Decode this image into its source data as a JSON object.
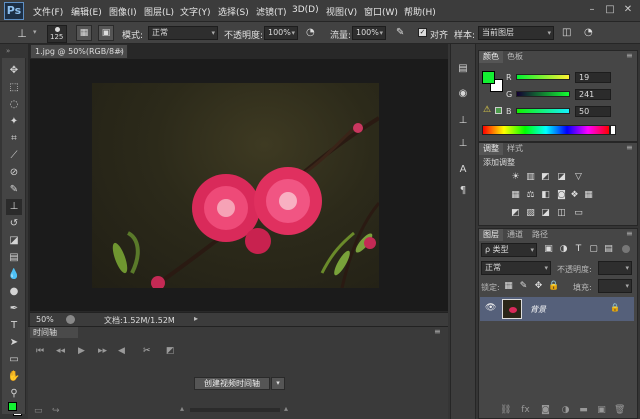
{
  "app": {
    "logo": "Ps"
  },
  "menu": [
    "文件(F)",
    "编辑(E)",
    "图像(I)",
    "图层(L)",
    "文字(Y)",
    "选择(S)",
    "滤镜(T)",
    "3D(D)",
    "视图(V)",
    "窗口(W)",
    "帮助(H)"
  ],
  "window_controls": [
    "–",
    "□",
    "✕"
  ],
  "options": {
    "brush_size": "125",
    "mode_label": "模式:",
    "mode_value": "正常",
    "opacity_label": "不透明度:",
    "opacity_value": "100%",
    "flow_label": "流量:",
    "flow_value": "100%",
    "align_label": "对齐",
    "sample_label": "样本:",
    "sample_value": "当前图层"
  },
  "document": {
    "tab_title": "1.jpg @ 50%(RGB/8#) *",
    "zoom": "50%",
    "doc_info": "文档:1.52M/1.52M"
  },
  "timeline": {
    "tab": "时间轴",
    "create_button": "创建视频时间轴"
  },
  "color_panel": {
    "tabs": [
      "颜色",
      "色板"
    ],
    "r_label": "R",
    "g_label": "G",
    "b_label": "B",
    "r_value": "19",
    "g_value": "241",
    "b_value": "50",
    "foreground": "#13f132"
  },
  "adjustments_panel": {
    "tabs": [
      "调整",
      "样式"
    ],
    "title": "添加调整"
  },
  "layers_panel": {
    "tabs": [
      "图层",
      "通道",
      "路径"
    ],
    "kind_label": "ρ 类型",
    "blend_mode": "正常",
    "opacity_label": "不透明度:",
    "fill_label": "填充:",
    "lock_label": "锁定:",
    "layer_name": "背景"
  }
}
